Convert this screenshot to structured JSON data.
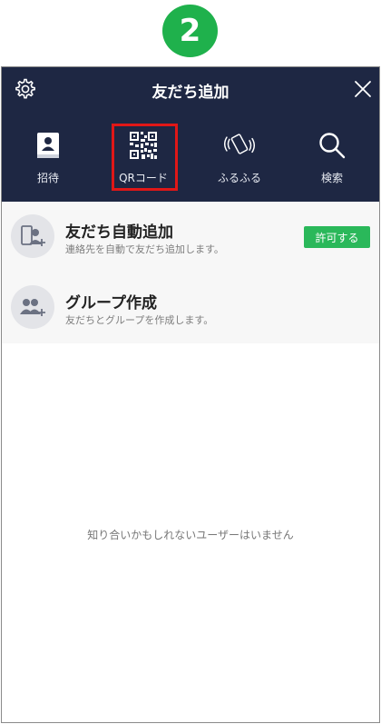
{
  "step_badge": "2",
  "header": {
    "title": "友だち追加",
    "icons": {
      "settings": "gear-icon",
      "close": "close-icon"
    }
  },
  "tabs": [
    {
      "label": "招待",
      "icon": "contact-book-icon"
    },
    {
      "label": "QRコード",
      "icon": "qr-code-icon",
      "highlighted": true
    },
    {
      "label": "ふるふる",
      "icon": "shake-phone-icon"
    },
    {
      "label": "検索",
      "icon": "search-icon"
    }
  ],
  "menu": [
    {
      "title": "友だち自動追加",
      "subtitle": "連絡先を自動で友だち追加します。",
      "icon": "phone-person-add-icon",
      "button_label": "許可する"
    },
    {
      "title": "グループ作成",
      "subtitle": "友だちとグループを作成します。",
      "icon": "group-add-icon"
    }
  ],
  "empty_message": "知り合いかもしれないユーザーはいません",
  "colors": {
    "header_bg": "#1e2743",
    "badge_green": "#1fb14c",
    "button_green": "#2ab85a",
    "highlight_red": "#e01717"
  }
}
